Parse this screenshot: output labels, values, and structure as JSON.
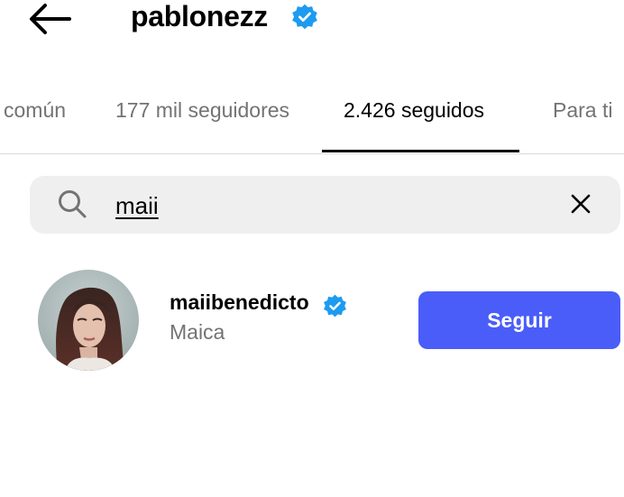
{
  "header": {
    "username": "pablonezz",
    "back_icon": "arrow-left-icon",
    "verified_icon": "verified-badge-icon"
  },
  "tabs": [
    {
      "label": "común",
      "active": false
    },
    {
      "label": "177 mil seguidores",
      "active": false
    },
    {
      "label": "2.426 seguidos",
      "active": true
    },
    {
      "label": "Para ti",
      "active": false
    }
  ],
  "search": {
    "value": "maii",
    "search_icon": "search-icon",
    "clear_icon": "close-icon"
  },
  "results": [
    {
      "username": "maiibenedicto",
      "full_name": "Maica",
      "verified": true,
      "follow_label": "Seguir"
    }
  ],
  "colors": {
    "verified": "#1d9bf0",
    "follow_button": "#4a5df9",
    "muted_text": "#737373",
    "search_bg": "#efefef"
  }
}
